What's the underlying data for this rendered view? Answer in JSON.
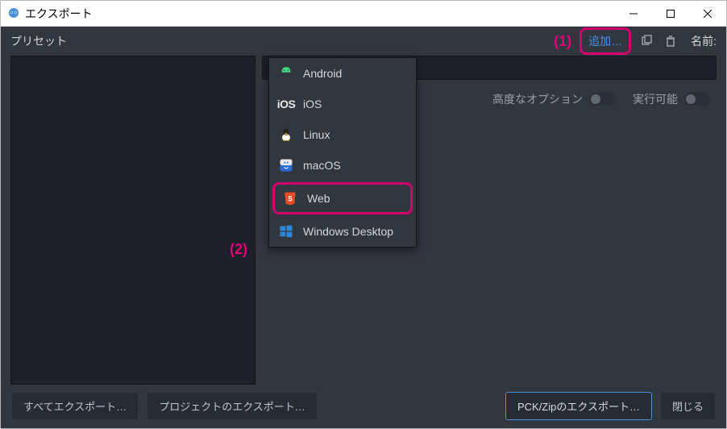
{
  "titlebar": {
    "title": "エクスポート"
  },
  "toolbar": {
    "preset_label": "プリセット",
    "annotation1": "(1)",
    "add_label": "追加…",
    "name_label": "名前:"
  },
  "annotation2": "(2)",
  "menu": {
    "items": [
      {
        "label": "Android"
      },
      {
        "label": "iOS"
      },
      {
        "label": "Linux"
      },
      {
        "label": "macOS"
      },
      {
        "label": "Web"
      },
      {
        "label": "Windows Desktop"
      }
    ]
  },
  "options": {
    "advanced_label": "高度なオプション",
    "runnable_label": "実行可能"
  },
  "buttons": {
    "export_all": "すべてエクスポート…",
    "export_project": "プロジェクトのエクスポート…",
    "export_pck": "PCK/Zipのエクスポート…",
    "close": "閉じる"
  }
}
